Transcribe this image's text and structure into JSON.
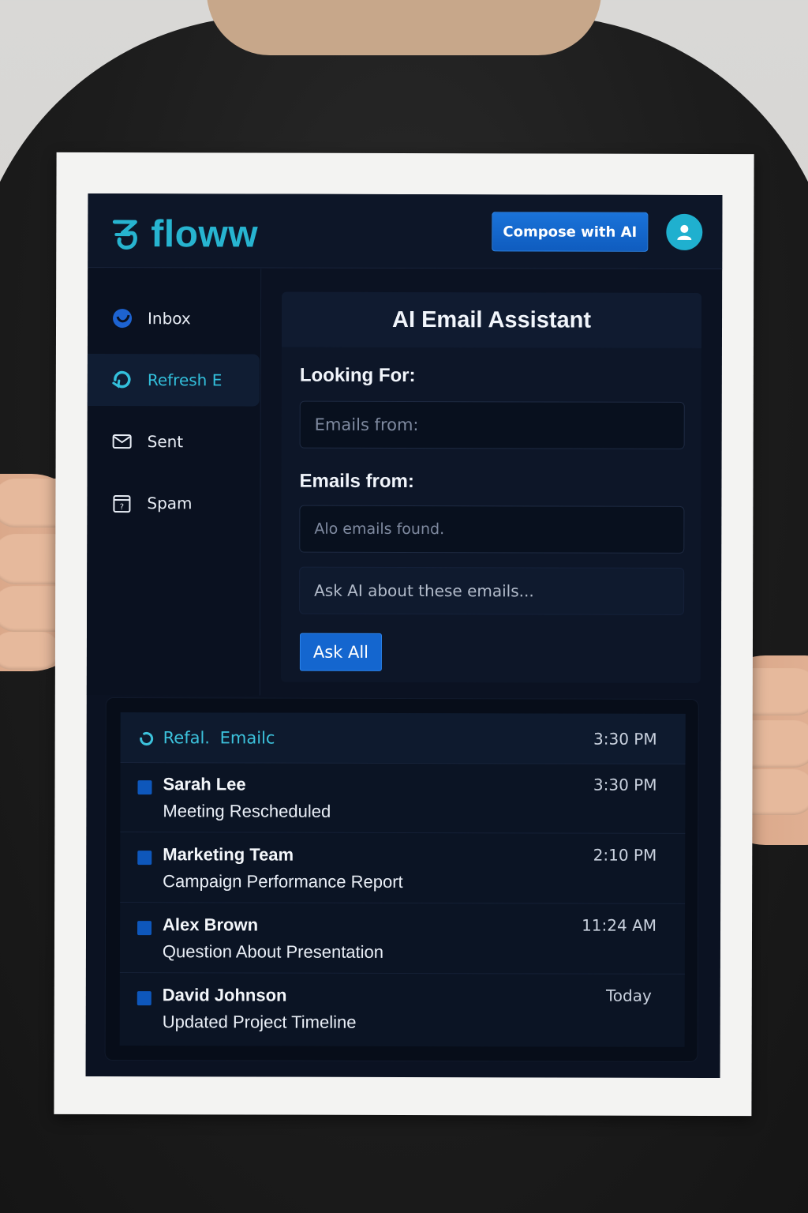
{
  "app": {
    "name": "floww",
    "compose_button": "Compose with AI"
  },
  "sidebar": {
    "items": [
      {
        "label": "Inbox",
        "icon": "inbox-icon"
      },
      {
        "label": "Refresh E",
        "icon": "refresh-icon",
        "active": true
      },
      {
        "label": "Sent",
        "icon": "envelope-icon"
      },
      {
        "label": "Spam",
        "icon": "spam-icon"
      }
    ]
  },
  "assistant": {
    "title": "AI Email Assistant",
    "looking_for_label": "Looking For:",
    "looking_for_placeholder": "Emails from:",
    "emails_from_label": "Emails from:",
    "results_text": "Alo emails found.",
    "ask_placeholder": "Ask AI about these emails...",
    "ask_button": "Ask All"
  },
  "email_list": {
    "header_left": "Refal.",
    "header_right": "Emailc",
    "header_time": "3:30 PM",
    "emails": [
      {
        "sender": "Sarah Lee",
        "subject": "Meeting Rescheduled",
        "time": "3:30 PM"
      },
      {
        "sender": "Marketing Team",
        "subject": "Campaign Performance Report",
        "time": "2:10 PM"
      },
      {
        "sender": "Alex Brown",
        "subject": "Question About Presentation",
        "time": "11:24 AM"
      },
      {
        "sender": "David Johnson",
        "subject": "Updated Project Timeline",
        "time": "Today"
      }
    ]
  },
  "colors": {
    "accent": "#27b4d0",
    "primary_button": "#1466cf",
    "background": "#0b1222"
  }
}
